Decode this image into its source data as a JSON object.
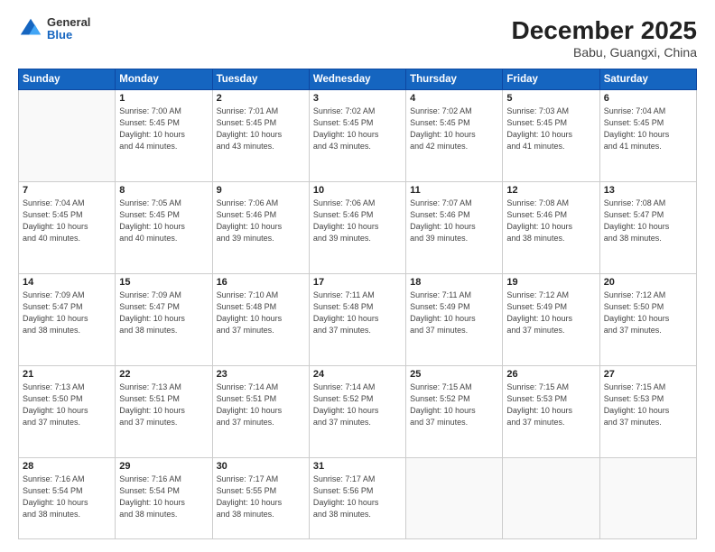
{
  "header": {
    "logo_general": "General",
    "logo_blue": "Blue",
    "title": "December 2025",
    "subtitle": "Babu, Guangxi, China"
  },
  "days_of_week": [
    "Sunday",
    "Monday",
    "Tuesday",
    "Wednesday",
    "Thursday",
    "Friday",
    "Saturday"
  ],
  "weeks": [
    [
      {
        "day": "",
        "info": ""
      },
      {
        "day": "1",
        "info": "Sunrise: 7:00 AM\nSunset: 5:45 PM\nDaylight: 10 hours\nand 44 minutes."
      },
      {
        "day": "2",
        "info": "Sunrise: 7:01 AM\nSunset: 5:45 PM\nDaylight: 10 hours\nand 43 minutes."
      },
      {
        "day": "3",
        "info": "Sunrise: 7:02 AM\nSunset: 5:45 PM\nDaylight: 10 hours\nand 43 minutes."
      },
      {
        "day": "4",
        "info": "Sunrise: 7:02 AM\nSunset: 5:45 PM\nDaylight: 10 hours\nand 42 minutes."
      },
      {
        "day": "5",
        "info": "Sunrise: 7:03 AM\nSunset: 5:45 PM\nDaylight: 10 hours\nand 41 minutes."
      },
      {
        "day": "6",
        "info": "Sunrise: 7:04 AM\nSunset: 5:45 PM\nDaylight: 10 hours\nand 41 minutes."
      }
    ],
    [
      {
        "day": "7",
        "info": "Sunrise: 7:04 AM\nSunset: 5:45 PM\nDaylight: 10 hours\nand 40 minutes."
      },
      {
        "day": "8",
        "info": "Sunrise: 7:05 AM\nSunset: 5:45 PM\nDaylight: 10 hours\nand 40 minutes."
      },
      {
        "day": "9",
        "info": "Sunrise: 7:06 AM\nSunset: 5:46 PM\nDaylight: 10 hours\nand 39 minutes."
      },
      {
        "day": "10",
        "info": "Sunrise: 7:06 AM\nSunset: 5:46 PM\nDaylight: 10 hours\nand 39 minutes."
      },
      {
        "day": "11",
        "info": "Sunrise: 7:07 AM\nSunset: 5:46 PM\nDaylight: 10 hours\nand 39 minutes."
      },
      {
        "day": "12",
        "info": "Sunrise: 7:08 AM\nSunset: 5:46 PM\nDaylight: 10 hours\nand 38 minutes."
      },
      {
        "day": "13",
        "info": "Sunrise: 7:08 AM\nSunset: 5:47 PM\nDaylight: 10 hours\nand 38 minutes."
      }
    ],
    [
      {
        "day": "14",
        "info": "Sunrise: 7:09 AM\nSunset: 5:47 PM\nDaylight: 10 hours\nand 38 minutes."
      },
      {
        "day": "15",
        "info": "Sunrise: 7:09 AM\nSunset: 5:47 PM\nDaylight: 10 hours\nand 38 minutes."
      },
      {
        "day": "16",
        "info": "Sunrise: 7:10 AM\nSunset: 5:48 PM\nDaylight: 10 hours\nand 37 minutes."
      },
      {
        "day": "17",
        "info": "Sunrise: 7:11 AM\nSunset: 5:48 PM\nDaylight: 10 hours\nand 37 minutes."
      },
      {
        "day": "18",
        "info": "Sunrise: 7:11 AM\nSunset: 5:49 PM\nDaylight: 10 hours\nand 37 minutes."
      },
      {
        "day": "19",
        "info": "Sunrise: 7:12 AM\nSunset: 5:49 PM\nDaylight: 10 hours\nand 37 minutes."
      },
      {
        "day": "20",
        "info": "Sunrise: 7:12 AM\nSunset: 5:50 PM\nDaylight: 10 hours\nand 37 minutes."
      }
    ],
    [
      {
        "day": "21",
        "info": "Sunrise: 7:13 AM\nSunset: 5:50 PM\nDaylight: 10 hours\nand 37 minutes."
      },
      {
        "day": "22",
        "info": "Sunrise: 7:13 AM\nSunset: 5:51 PM\nDaylight: 10 hours\nand 37 minutes."
      },
      {
        "day": "23",
        "info": "Sunrise: 7:14 AM\nSunset: 5:51 PM\nDaylight: 10 hours\nand 37 minutes."
      },
      {
        "day": "24",
        "info": "Sunrise: 7:14 AM\nSunset: 5:52 PM\nDaylight: 10 hours\nand 37 minutes."
      },
      {
        "day": "25",
        "info": "Sunrise: 7:15 AM\nSunset: 5:52 PM\nDaylight: 10 hours\nand 37 minutes."
      },
      {
        "day": "26",
        "info": "Sunrise: 7:15 AM\nSunset: 5:53 PM\nDaylight: 10 hours\nand 37 minutes."
      },
      {
        "day": "27",
        "info": "Sunrise: 7:15 AM\nSunset: 5:53 PM\nDaylight: 10 hours\nand 37 minutes."
      }
    ],
    [
      {
        "day": "28",
        "info": "Sunrise: 7:16 AM\nSunset: 5:54 PM\nDaylight: 10 hours\nand 38 minutes."
      },
      {
        "day": "29",
        "info": "Sunrise: 7:16 AM\nSunset: 5:54 PM\nDaylight: 10 hours\nand 38 minutes."
      },
      {
        "day": "30",
        "info": "Sunrise: 7:17 AM\nSunset: 5:55 PM\nDaylight: 10 hours\nand 38 minutes."
      },
      {
        "day": "31",
        "info": "Sunrise: 7:17 AM\nSunset: 5:56 PM\nDaylight: 10 hours\nand 38 minutes."
      },
      {
        "day": "",
        "info": ""
      },
      {
        "day": "",
        "info": ""
      },
      {
        "day": "",
        "info": ""
      }
    ]
  ]
}
